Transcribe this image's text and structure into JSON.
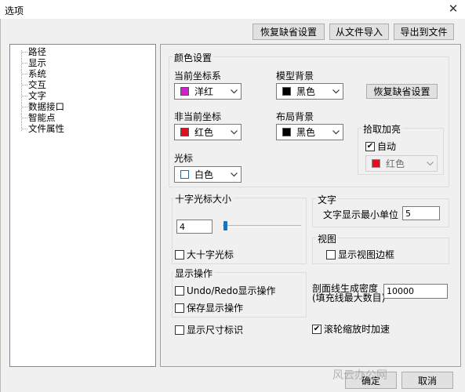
{
  "window": {
    "title": "选项",
    "close_icon": "close-icon"
  },
  "toolbar": {
    "restore_defaults": "恢复缺省设置",
    "import": "从文件导入",
    "export": "导出到文件"
  },
  "tree": {
    "items": [
      "路径",
      "显示",
      "系统",
      "交互",
      "文字",
      "数据接口",
      "智能点",
      "文件属性"
    ]
  },
  "color_settings": {
    "group_title": "颜色设置",
    "current_axis": {
      "label": "当前坐标系",
      "value": "洋红",
      "color": "#d020d0"
    },
    "model_bg": {
      "label": "模型背景",
      "value": "黑色",
      "color": "#000000"
    },
    "restore_button": "恢复缺省设置",
    "non_current_axis": {
      "label": "非当前坐标",
      "value": "红色",
      "color": "#e01020"
    },
    "layout_bg": {
      "label": "布局背景",
      "value": "黑色",
      "color": "#000000"
    },
    "cursor": {
      "label": "光标",
      "value": "白色",
      "color": "#ffffff"
    },
    "pick_highlight": {
      "title": "拾取加亮",
      "auto_label": "自动",
      "auto_checked": true,
      "value": "红色",
      "color": "#e01020"
    }
  },
  "crosshair": {
    "group_title": "十字光标大小",
    "size_value": "4",
    "slider_value": 4,
    "big_cross_label": "大十字光标",
    "big_cross_checked": false
  },
  "text": {
    "group_title": "文字",
    "min_unit_label": "文字显示最小单位",
    "min_unit_value": "5"
  },
  "view": {
    "group_title": "视图",
    "show_border_label": "显示视图边框",
    "show_border_checked": false
  },
  "display_ops": {
    "group_title": "显示操作",
    "undo_redo_label": "Undo/Redo显示操作",
    "undo_redo_checked": false,
    "save_label": "保存显示操作",
    "save_checked": false
  },
  "hatch": {
    "label_line1": "剖面线生成密度",
    "label_line2": "(填充线最大数目)",
    "value": "10000"
  },
  "size_marks": {
    "label": "显示尺寸标识",
    "checked": false
  },
  "wheel": {
    "label": "滚轮缩放时加速",
    "checked": true
  },
  "footer": {
    "ok": "确定",
    "cancel": "取消"
  },
  "watermark": "风云办公网"
}
